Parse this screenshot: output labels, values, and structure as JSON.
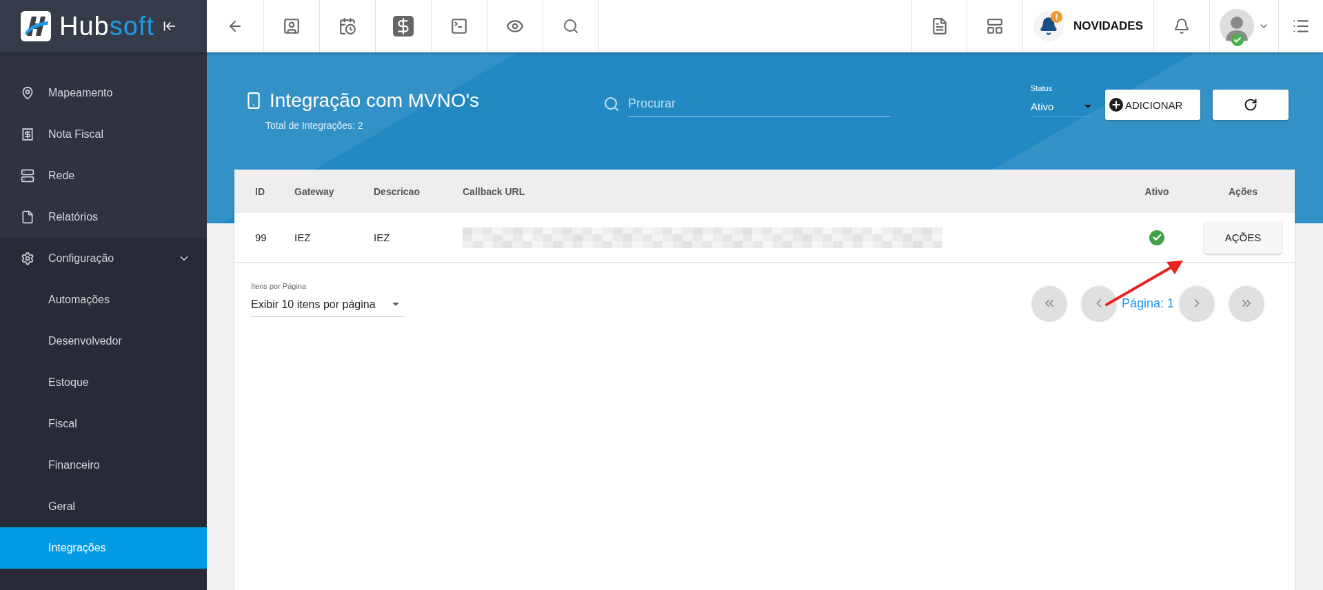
{
  "logo": {
    "lead": "Hub",
    "accent": "soft"
  },
  "topbar": {
    "news": {
      "label": "NOVIDADES",
      "badge": "!"
    },
    "user": {
      "online": true
    }
  },
  "sidebar": {
    "items": [
      {
        "label": "Mapeamento",
        "selected": false
      },
      {
        "label": "Nota Fiscal",
        "selected": false
      },
      {
        "label": "Rede",
        "selected": false
      },
      {
        "label": "Relatórios",
        "selected": false
      },
      {
        "label": "Configuração",
        "selected": false,
        "expanded": true,
        "children": [
          {
            "label": "Automações",
            "selected": false
          },
          {
            "label": "Desenvolvedor",
            "selected": false
          },
          {
            "label": "Estoque",
            "selected": false
          },
          {
            "label": "Fiscal",
            "selected": false
          },
          {
            "label": "Financeiro",
            "selected": false
          },
          {
            "label": "Geral",
            "selected": false
          },
          {
            "label": "Integrações",
            "selected": true
          }
        ]
      }
    ]
  },
  "page": {
    "title": "Integração com MVNO's",
    "subtitle": "Total de Integrações: 2"
  },
  "search": {
    "placeholder": "Procurar"
  },
  "status_filter": {
    "label": "Status",
    "value": "Ativo"
  },
  "add_button": "ADICIONAR",
  "table": {
    "columns": [
      "ID",
      "Gateway",
      "Descricao",
      "Callback URL",
      "Ativo",
      "Ações"
    ],
    "rows": [
      {
        "id": "99",
        "gateway": "IEZ",
        "descricao": "IEZ",
        "ativo": true,
        "action": "AÇÕES"
      }
    ]
  },
  "pagination": {
    "per_page_label": "Itens por Página",
    "per_page_value": "Exibir 10 itens por página",
    "page": "Página: 1"
  }
}
